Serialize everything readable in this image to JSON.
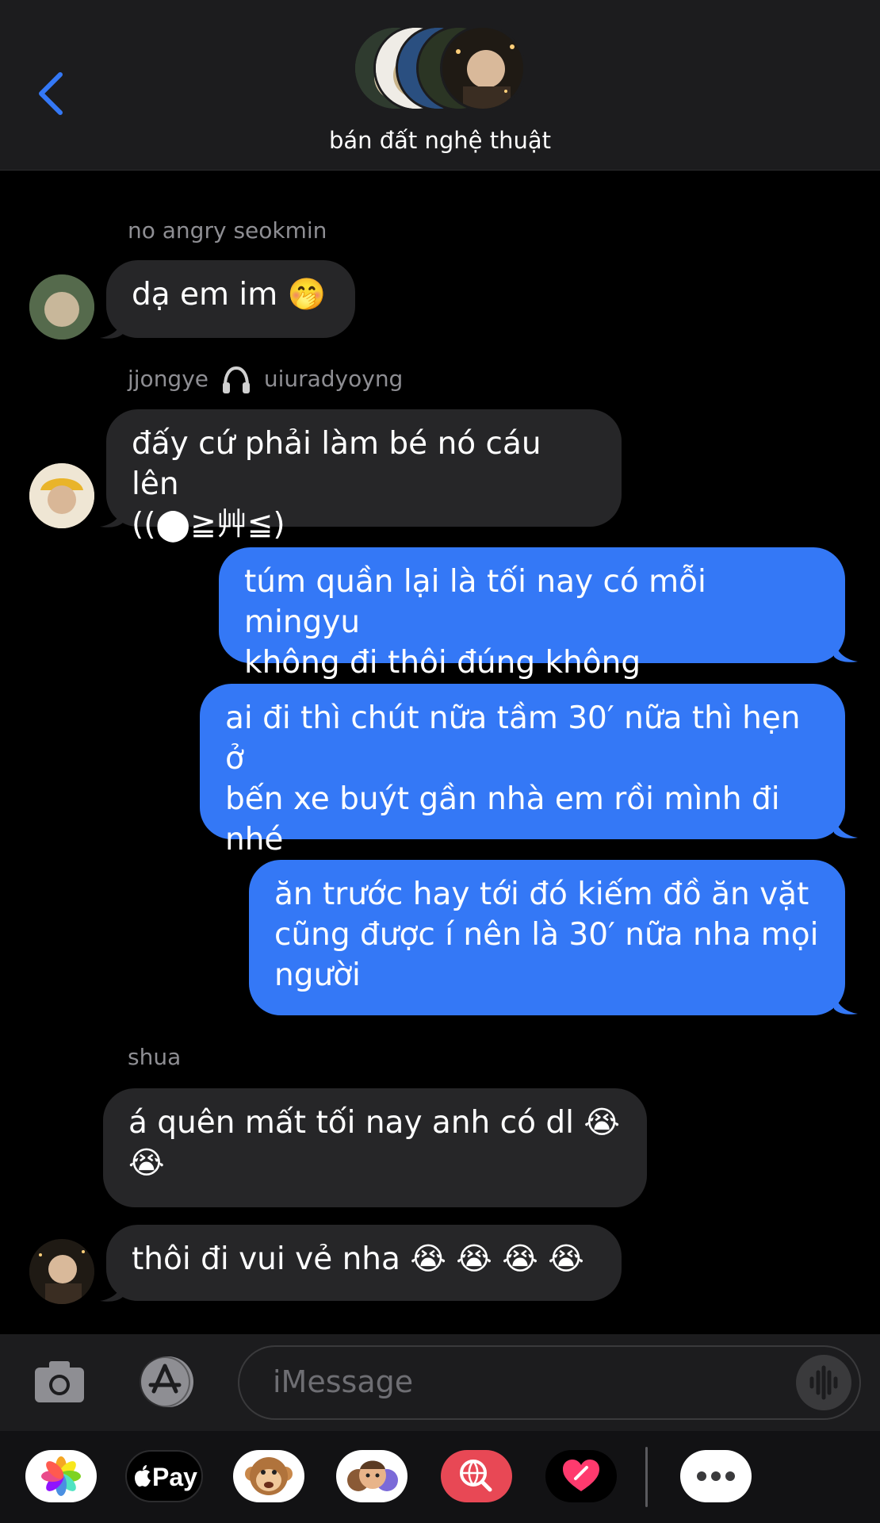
{
  "header": {
    "title": "bán đất nghệ thuật"
  },
  "messages": [
    {
      "sender": "no angry seokmin",
      "text": "dạ em im 🤭"
    },
    {
      "sender_parts": [
        "jjongye",
        "uiuradyoyng"
      ],
      "text_line1": "đấy cứ phải làm bé nó cáu lên",
      "text_line2": "((⬤≧艸≦)"
    },
    {
      "text_line1": "túm quần lại là tối nay có mỗi mingyu",
      "text_line2": "không đi thôi đúng không"
    },
    {
      "text_line1": "ai đi thì chút nữa tầm 30′ nữa thì hẹn ở",
      "text_line2": "bến xe buýt gần nhà em rồi mình đi",
      "text_line3": "nhé"
    },
    {
      "text_line1": "ăn trước hay tới đó kiếm đồ ăn vặt",
      "text_line2": "cũng được í nên là 30′ nữa nha mọi",
      "text_line3": "người"
    },
    {
      "sender": "shua",
      "text_line1": "á quên mất tối nay anh có dl 😭",
      "text_line2": "😭"
    },
    {
      "text": "thôi đi vui vẻ nha 😭 😭 😭 😭"
    }
  ],
  "input": {
    "placeholder": "iMessage"
  },
  "apps": {
    "apple_pay_label": "Pay",
    "items": [
      "photos-app",
      "apple-pay-app",
      "animoji-app",
      "memoji-app",
      "search-images-app",
      "digital-touch-app",
      "more-apps"
    ]
  },
  "colors": {
    "outgoing_bubble": "#3478f6",
    "incoming_bubble": "#262628",
    "accent": "#3478f6"
  }
}
